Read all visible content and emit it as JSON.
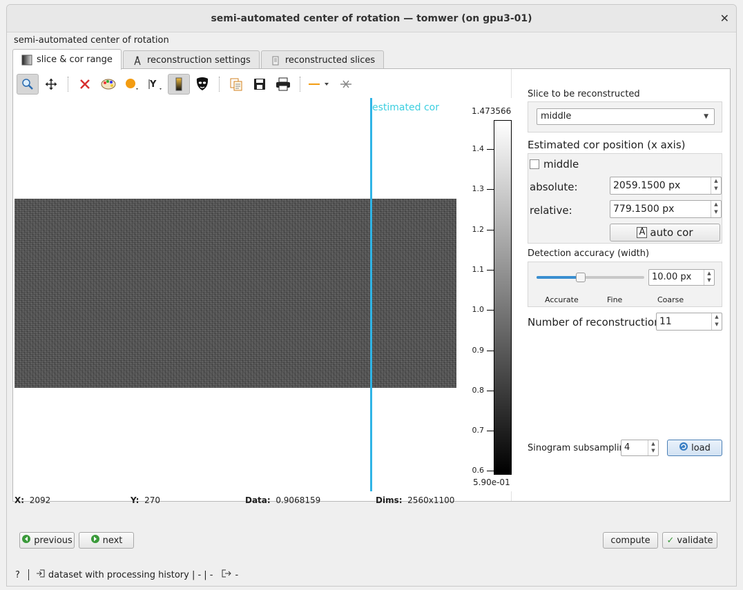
{
  "window": {
    "title": "semi-automated center of rotation — tomwer (on gpu3-01)",
    "close_glyph": "✕"
  },
  "header": {
    "label": "semi-automated center of rotation"
  },
  "tabs": [
    {
      "label": "slice & cor range",
      "icon": "slice-icon",
      "active": true
    },
    {
      "label": "reconstruction settings",
      "icon": "compass-icon",
      "active": false
    },
    {
      "label": "reconstructed slices",
      "icon": "document-icon",
      "active": false
    }
  ],
  "toolbar": {
    "icons": [
      "zoom-icon",
      "pan-icon",
      "reset-zoom-icon",
      "colormap-icon",
      "marker-icon",
      "y-axis-icon",
      "colorbar-icon",
      "mask-icon",
      "copy-icon",
      "save-icon",
      "print-icon",
      "line-style-icon",
      "clear-profile-icon"
    ]
  },
  "plot": {
    "cor_label": "estimated cor",
    "colorbar": {
      "max_label": "1.473566",
      "min_label": "5.90e-01",
      "ticks": [
        "1.4",
        "1.3",
        "1.2",
        "1.1",
        "1.0",
        "0.9",
        "0.8",
        "0.7",
        "0.6"
      ]
    },
    "line_color": "#2fb4e6"
  },
  "status": {
    "x_label": "X:",
    "x_value": "2092",
    "y_label": "Y:",
    "y_value": "270",
    "data_label": "Data:",
    "data_value": "0.9068159",
    "dims_label": "Dims:",
    "dims_value": "2560x1100"
  },
  "panel": {
    "slice_label": "Slice to be reconstructed",
    "slice_value": "middle",
    "cor_title": "Estimated cor position (x axis)",
    "middle_label": "middle",
    "absolute_label": "absolute:",
    "absolute_value": "2059.1500 px",
    "relative_label": "relative:",
    "relative_value": "779.1500 px",
    "auto_cor_icon_text": "A",
    "auto_cor_label": "auto cor",
    "accuracy_title": "Detection accuracy (width)",
    "accuracy_value": "10.00 px",
    "accuracy_slider_fraction": 0.4,
    "accuracy_labels": [
      "Accurate",
      "Fine",
      "Coarse"
    ],
    "nrecon_label": "Number of reconstruction",
    "nrecon_value": "11",
    "subsampling_label": "Sinogram subsamplin",
    "subsampling_value": "4",
    "load_label": "load"
  },
  "actions": {
    "previous": "previous",
    "next": "next",
    "compute": "compute",
    "validate": "validate"
  },
  "footer": {
    "help": "?",
    "dataset_text": "dataset with processing history | - | -",
    "output_text": "-"
  }
}
